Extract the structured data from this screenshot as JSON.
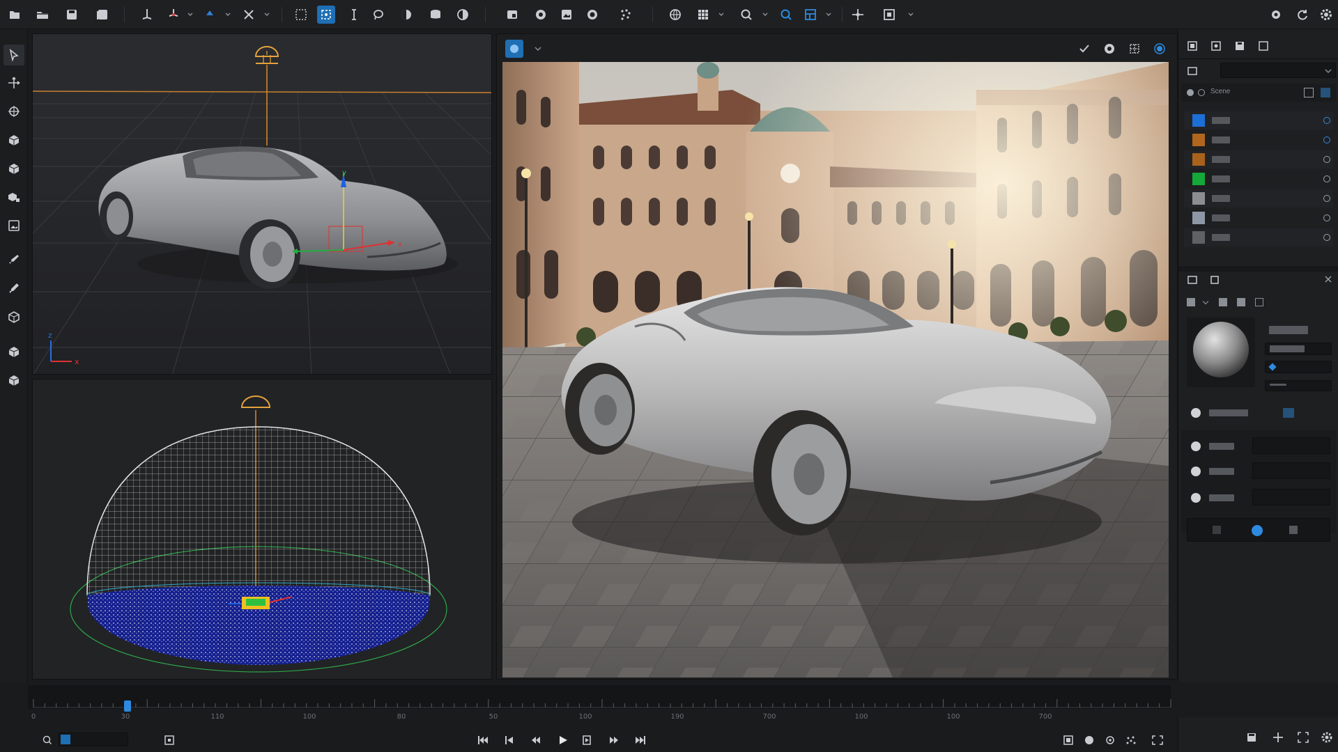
{
  "toolbar": {
    "icons": [
      "new-file-icon",
      "open-folder-icon",
      "save-icon",
      "save-all-icon",
      "axis-icon",
      "snap-icon",
      "gizmo-icon",
      "transform-icon",
      "box-select-icon",
      "focus-icon",
      "text-cursor-icon",
      "lasso-icon",
      "sphere-icon",
      "mesh-icon",
      "half-tone-icon",
      "render-region-icon",
      "refresh-icon",
      "render-image-icon",
      "camera-icon",
      "scatter-icon",
      "globe-icon",
      "grid-icon",
      "search-icon",
      "zoom-icon",
      "layout-icon",
      "move-icon",
      "frame-icon",
      "settings-icon",
      "sync-icon",
      "gear-icon"
    ]
  },
  "left_tools": [
    "select-tool",
    "move-tool",
    "rotate-tool",
    "cube-tool",
    "cube-alt-tool",
    "multi-cube-tool",
    "image-tool",
    "brush-tool",
    "paint-tool",
    "material-tool",
    "cube-small-tool",
    "cube-paint-tool"
  ],
  "viewport_top": {
    "gizmo_labels": {
      "x": "x",
      "y": "y",
      "z": "z"
    }
  },
  "render_view": {
    "toolbar_icons": [
      "render-mode-icon",
      "history-icon",
      "checkmark-icon",
      "sphere-toggle-icon",
      "grid-toggle-icon",
      "active-render-icon"
    ]
  },
  "right_panel": {
    "layer_header": "Scene",
    "layers": [
      {
        "color": "#1d6fd8"
      },
      {
        "color": "#b0661e"
      },
      {
        "color": "#a8621c"
      },
      {
        "color": "#14a83a"
      },
      {
        "color": "#8a8d91"
      },
      {
        "color": "#8e97a6"
      },
      {
        "color": "#5f6165"
      }
    ]
  },
  "timeline": {
    "ticks": [
      "0",
      "30",
      "110",
      "100",
      "80",
      "50",
      "100",
      "190",
      "700",
      "100",
      "100",
      "700"
    ],
    "playhead_frame": 30
  },
  "colors": {
    "accent": "#1f6fb4",
    "orange": "#e08a2a"
  }
}
